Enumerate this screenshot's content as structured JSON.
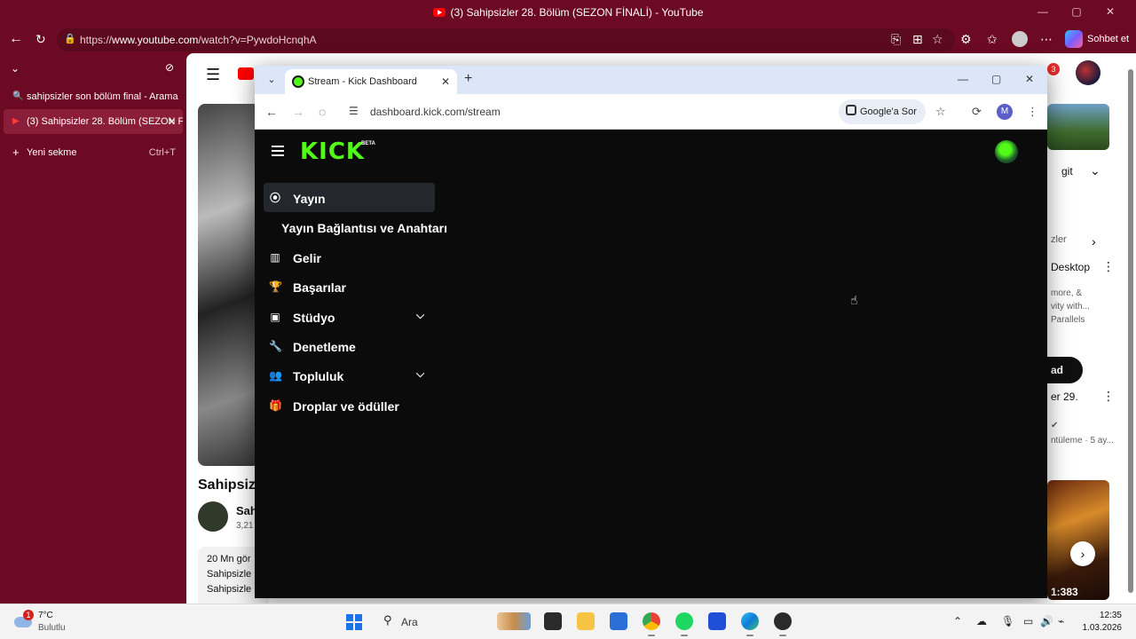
{
  "edge": {
    "window_title": "(3) Sahipsizler 28. Bölüm (SEZON FİNALİ) - YouTube",
    "url_prefix": "https://",
    "url_host": "www.youtube.com",
    "url_path": "/watch?v=PywdoHcnqhA",
    "sohbet_label": "Sohbet et",
    "tabs": [
      {
        "title": "sahipsizler son bölüm final - Arama"
      },
      {
        "title": "(3) Sahipsizler 28. Bölüm (SEZON F"
      },
      {
        "title": "Yeni sekme",
        "shortcut": "Ctrl+T"
      }
    ]
  },
  "youtube": {
    "notification_count": "3",
    "title_fragment": "Sahipsiz",
    "channel_fragment": "Sah",
    "subs_fragment": "3,21",
    "desc_lines": [
      "20 Mn gör",
      "Sahipsizle",
      "Sahipsizle"
    ],
    "right_texts": {
      "r1": "git",
      "r2": "zler",
      "r3": "Desktop",
      "r4": "more, &",
      "r5": "vity with...",
      "r6": "Parallels",
      "r7": "ad",
      "r8": "er 29.",
      "r9": "ntüleme · 5 ay...",
      "thumb_time": "1:383"
    }
  },
  "chrome": {
    "tab_title": "Stream - Kick Dashboard",
    "url": "dashboard.kick.com/stream",
    "ask_google": "Google'a Sor",
    "profile_initial": "M"
  },
  "kick": {
    "logo": "KICK",
    "beta": "BETA",
    "menu": [
      {
        "label": "Yayın",
        "icon": "broadcast-icon"
      },
      {
        "label": "Yayın Bağlantısı ve Anahtarı"
      },
      {
        "label": "Gelir",
        "icon": "bar-chart-icon"
      },
      {
        "label": "Başarılar",
        "icon": "trophy-icon"
      },
      {
        "label": "Stüdyo",
        "icon": "studio-icon"
      },
      {
        "label": "Denetleme",
        "icon": "wrench-icon"
      },
      {
        "label": "Topluluk",
        "icon": "community-icon"
      },
      {
        "label": "Droplar ve ödüller",
        "icon": "gift-icon"
      }
    ]
  },
  "taskbar": {
    "weather_badge": "1",
    "temperature": "7°C",
    "condition": "Bulutlu",
    "search_label": "Ara",
    "time": "12:35",
    "date": "1.03.2026"
  }
}
